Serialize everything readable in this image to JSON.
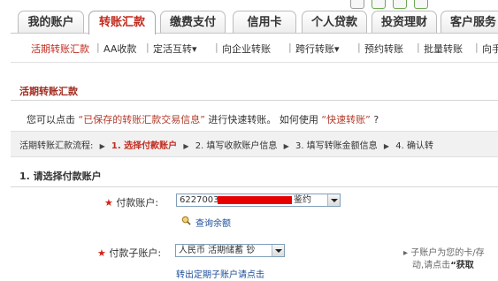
{
  "tabs": [
    {
      "label": "我的账户",
      "active": false
    },
    {
      "label": "转账汇款",
      "active": true
    },
    {
      "label": "缴费支付",
      "active": false
    },
    {
      "label": "信用卡",
      "active": false
    },
    {
      "label": "个人贷款",
      "active": false
    },
    {
      "label": "投资理财",
      "active": false
    },
    {
      "label": "客户服务",
      "active": false
    }
  ],
  "subnav": [
    {
      "label": "活期转账汇款",
      "active": true
    },
    {
      "label": "AA收款"
    },
    {
      "label": "定活互转▾"
    },
    {
      "label": "向企业转账"
    },
    {
      "label": "跨行转账▾"
    },
    {
      "label": "预约转账"
    },
    {
      "label": "批量转账"
    },
    {
      "label": "向手"
    }
  ],
  "section_title": "活期转账汇款",
  "hint": {
    "prefix": "您可以点击",
    "quoted1": "“已保存的转账汇款交易信息”",
    "middle": "进行快速转账。 如何使用",
    "quoted2": "“快速转账”",
    "suffix": "?"
  },
  "flow": {
    "label": "活期转账汇款流程:",
    "steps": [
      "1. 选择付款账户",
      "2. 填写收款账户信息",
      "3. 填写转账金额信息",
      "4. 确认转"
    ]
  },
  "step_title": "1. 请选择付款账户",
  "form": {
    "account_label": "付款账户:",
    "account_value_prefix": "6227003",
    "account_value_suffix": "鉴约",
    "query_balance": "查询余额",
    "subaccount_label": "付款子账户:",
    "subaccount_value": "人民币 活期储蓄 钞",
    "fixed_link": "转出定期子账户请点击",
    "note_line1": "▸ 子账户为您的卡/存",
    "note_line2_prefix": "动,请点击",
    "note_line2_bold": "“获取"
  },
  "colors": {
    "accent_red": "#c22b1f",
    "mask_red": "#e60000",
    "link_blue": "#1c4e9a"
  }
}
